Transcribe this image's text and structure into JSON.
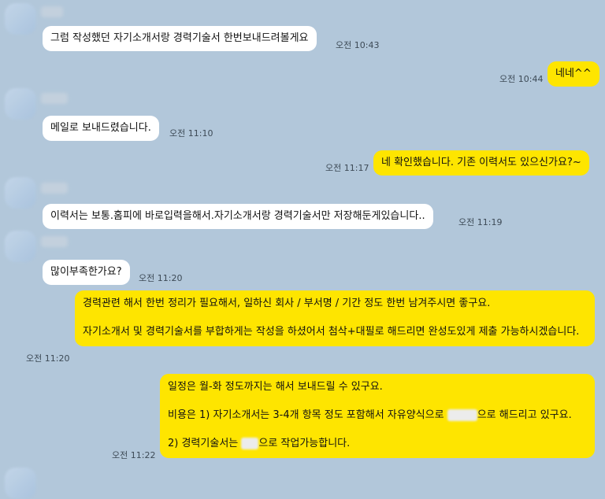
{
  "chat": {
    "messages": [
      {
        "side": "in",
        "text": "그럼 작성했던 자기소개서랑 경력기술서 한번보내드려볼게요",
        "time": "오전 10:43"
      },
      {
        "side": "out",
        "text": "네네^^",
        "time": "오전 10:44"
      },
      {
        "side": "in",
        "text": "메일로 보내드렸습니다.",
        "time": "오전 11:10"
      },
      {
        "side": "out",
        "text": "네 확인했습니다. 기존 이력서도 있으신가요?~",
        "time": "오전 11:17"
      },
      {
        "side": "in",
        "text": "이력서는 보통.홈피에 바로입력을해서.자기소개서랑 경력기술서만 저장해둔게있습니다..",
        "time": "오전 11:19"
      },
      {
        "side": "in",
        "text": "많이부족한가요?",
        "time": "오전 11:20"
      },
      {
        "side": "out",
        "line1": "경력관련 해서 한번 정리가 필요해서, 일하신 회사 / 부서명 / 기간 정도 한번 남겨주시면 좋구요.",
        "line2": "자기소개서 및 경력기술서를 부합하게는 작성을 하셨어서 첨삭+대필로 해드리면 완성도있게 제출 가능하시겠습니다.",
        "time": "오전 11:20"
      },
      {
        "side": "out",
        "line1": "일정은 월-화 정도까지는 해서 보내드릴 수 있구요.",
        "line2a": "비용은 1) 자기소개서는 3-4개 항목 정도 포함해서 자유양식으로 ",
        "line2b": "으로 해드리고 있구요.",
        "line3a": "2) 경력기술서는 ",
        "line3b": "으로 작업가능합니다.",
        "time": "오전 11:22"
      }
    ]
  }
}
